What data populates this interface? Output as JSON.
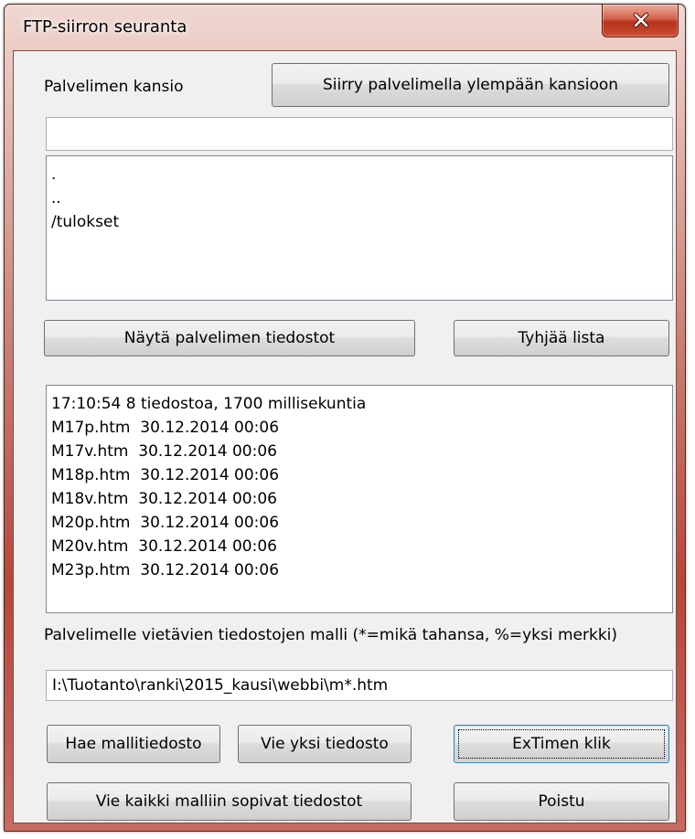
{
  "window": {
    "title": "FTP-siirron seuranta"
  },
  "server": {
    "folder_label": "Palvelimen kansio",
    "up_button": "Siirry palvelimella ylempään kansioon",
    "folder_value": "",
    "folder_items": [
      ".",
      "..",
      "/tulokset"
    ],
    "show_files_button": "Näytä palvelimen tiedostot",
    "clear_list_button": "Tyhjää lista"
  },
  "log": {
    "lines": [
      "17:10:54 8 tiedostoa, 1700 millisekuntia",
      "M17p.htm  30.12.2014 00:06",
      "M17v.htm  30.12.2014 00:06",
      "M18p.htm  30.12.2014 00:06",
      "M18v.htm  30.12.2014 00:06",
      "M20p.htm  30.12.2014 00:06",
      "M20v.htm  30.12.2014 00:06",
      "M23p.htm  30.12.2014 00:06"
    ]
  },
  "pattern": {
    "label": "Palvelimelle vietävien tiedostojen malli (*=mikä tahansa, %=yksi merkki)",
    "value": "I:\\Tuotanto\\ranki\\2015_kausi\\webbi\\m*.htm"
  },
  "buttons": {
    "fetch_template": "Hae mallitiedosto",
    "send_one": "Vie yksi tiedosto",
    "extimen_click": "ExTimen klik",
    "send_all": "Vie kaikki malliin sopivat tiedostot",
    "exit": "Poistu"
  },
  "icons": {
    "close": "close-icon"
  },
  "colors": {
    "close_button": "#c94a34",
    "focus_border": "#3c7fb1"
  }
}
